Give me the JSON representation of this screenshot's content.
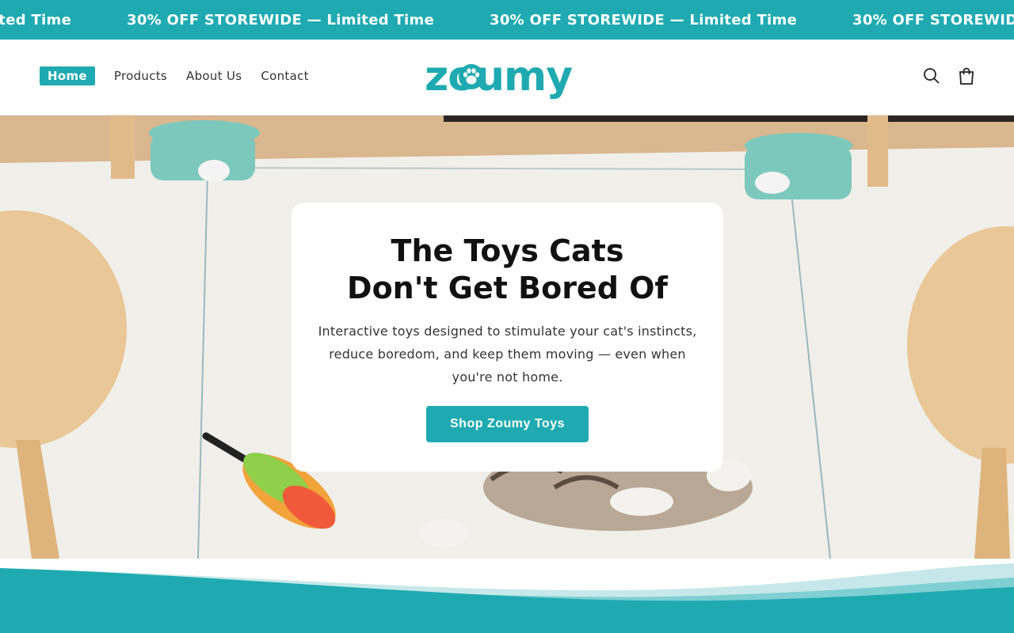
{
  "announcement": {
    "items": [
      "30% OFF STOREWIDE — Limited Time",
      "30% OFF STOREWIDE — Limited Time",
      "30% OFF STOREWIDE — Limited Time",
      "30% OFF STOREWIDE — Limited Time"
    ]
  },
  "nav": {
    "items": [
      {
        "label": "Home",
        "active": true
      },
      {
        "label": "Products"
      },
      {
        "label": "About Us"
      },
      {
        "label": "Contact"
      }
    ]
  },
  "brand": {
    "name": "zoumy",
    "color": "#1eaab0"
  },
  "icons": {
    "search": "search-icon",
    "cart": "shopping-bag-icon",
    "paw": "paw-icon"
  },
  "hero": {
    "title": "The Toys Cats Don't Get Bored Of",
    "subtitle": "Interactive toys designed to stimulate your cat's instincts, reduce boredom, and keep them moving — even when you're not home.",
    "cta": "Shop Zoumy Toys"
  },
  "colors": {
    "accent": "#1eaab0",
    "text": "#111111"
  }
}
